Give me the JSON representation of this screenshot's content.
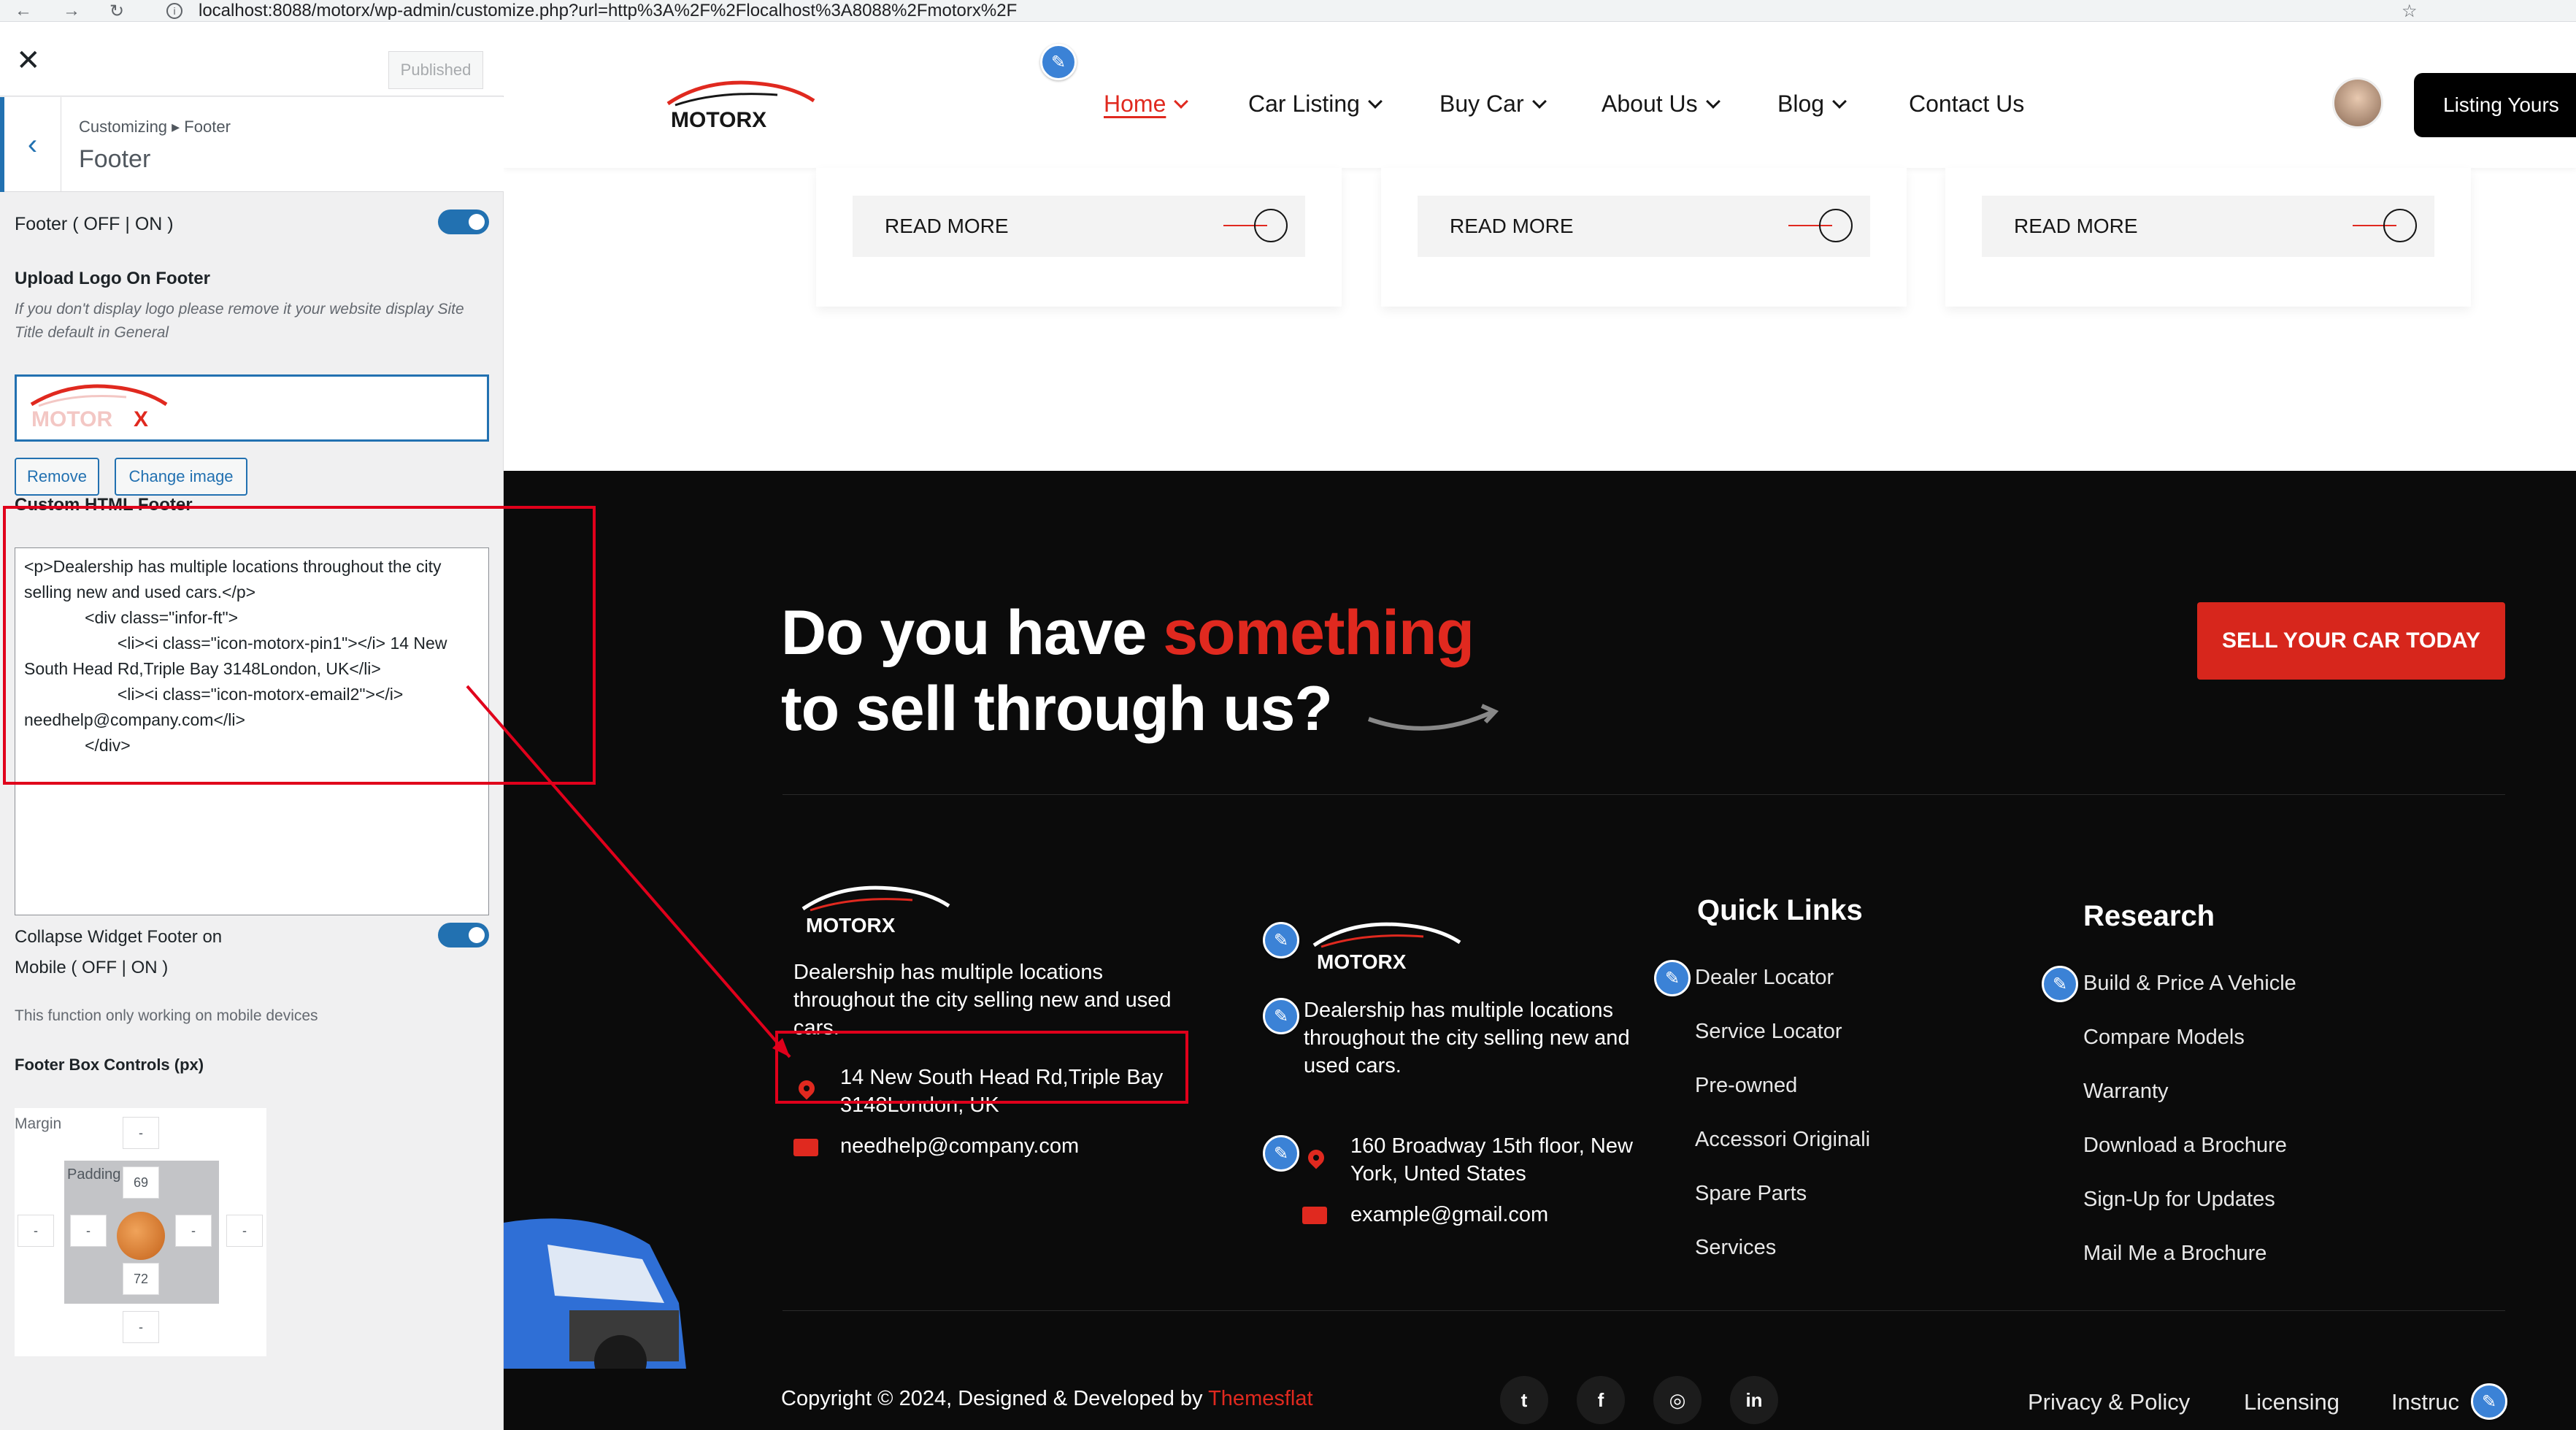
{
  "browser": {
    "url": "localhost:8088/motorx/wp-admin/customize.php?url=http%3A%2F%2Flocalhost%3A8088%2Fmotorx%2F",
    "back": "←",
    "forward": "→",
    "reload": "↻",
    "star": "☆"
  },
  "customizer": {
    "close": "✕",
    "published": "Published",
    "back": "‹",
    "breadcrumb": "Customizing ▸ Footer",
    "section_title": "Footer",
    "footer_toggle_label": "Footer ( OFF | ON )",
    "upload_logo_label": "Upload Logo On Footer",
    "upload_logo_desc": "If you don't display logo please remove it your website display Site Title default in General",
    "remove_btn": "Remove",
    "change_image_btn": "Change image",
    "custom_html_label": "Custom HTML Footer",
    "custom_html_value": "<p>Dealership has multiple locations throughout the city selling new and used cars.</p>\n             <div class=\"infor-ft\">\n                    <li><i class=\"icon-motorx-pin1\"></i> 14 New South Head Rd,Triple Bay 3148London, UK</li>\n                    <li><i class=\"icon-motorx-email2\"></i> needhelp@company.com</li>\n             </div>",
    "collapse_label_1": "Collapse Widget Footer on",
    "collapse_label_2": "Mobile ( OFF | ON )",
    "collapse_note": "This function only working on mobile devices",
    "box_controls_label": "Footer Box Controls (px)",
    "margin_label": "Margin",
    "padding_label": "Padding",
    "padding_top": "69",
    "padding_bottom": "72",
    "dash": "-",
    "colors": {
      "accent": "#2271b1"
    }
  },
  "site": {
    "logo_text": "MOTORX",
    "menu": [
      {
        "label": "Home",
        "active": true
      },
      {
        "label": "Car Listing"
      },
      {
        "label": "Buy Car"
      },
      {
        "label": "About Us"
      },
      {
        "label": "Blog"
      },
      {
        "label": "Contact Us"
      }
    ],
    "listing_btn": "Listing Yours",
    "read_more": "READ MORE",
    "cta_line1_a": "Do you have ",
    "cta_line1_b": "something",
    "cta_line2": "to sell through us?",
    "sell_btn": "SELL YOUR CAR TODAY",
    "col1": {
      "desc": "Dealership has multiple locations throughout the city selling new and used cars.",
      "address": "14 New South Head Rd,Triple Bay 3148London, UK",
      "email": "needhelp@company.com"
    },
    "col2": {
      "desc": "Dealership has multiple locations throughout the city selling new and used cars.",
      "address": "160 Broadway 15th floor, New York, Unted States",
      "email": "example@gmail.com"
    },
    "quick_links": {
      "title": "Quick Links",
      "items": [
        "Dealer Locator",
        "Service Locator",
        "Pre-owned",
        "Accessori Originali",
        "Spare Parts",
        "Services"
      ]
    },
    "research": {
      "title": "Research",
      "items": [
        "Build & Price A Vehicle",
        "Compare Models",
        "Warranty",
        "Download a Brochure",
        "Sign-Up for Updates",
        "Mail Me a Brochure"
      ]
    },
    "copyright_a": "Copyright © 2024, Designed & Developed by ",
    "copyright_b": "Themesflat",
    "social": [
      "t",
      "f",
      "◎",
      "in"
    ],
    "bottom_links": [
      "Privacy & Policy",
      "Licensing",
      "Instruc"
    ],
    "pencil": "✎",
    "colors": {
      "brand_red": "#e0291f",
      "footer_bg": "#0b0b0b",
      "edit_blue": "#3b82d6"
    }
  }
}
